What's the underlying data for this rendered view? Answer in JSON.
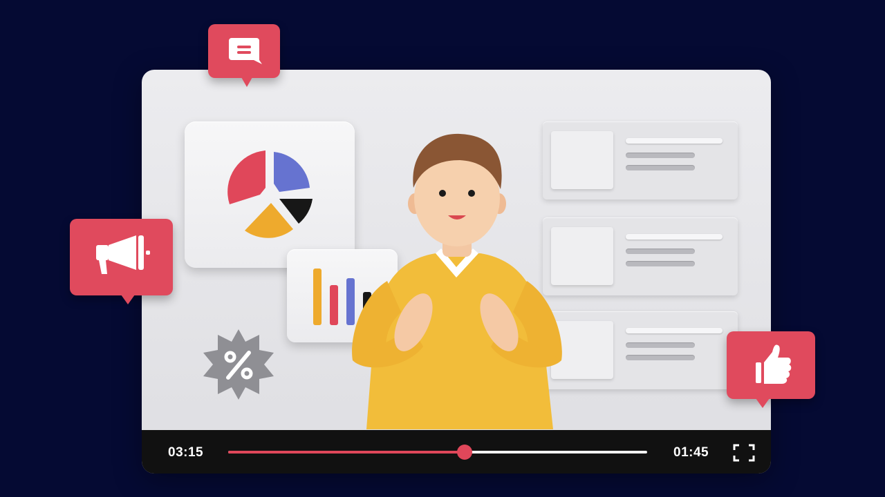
{
  "player": {
    "time_elapsed": "03:15",
    "time_remaining": "01:45",
    "progress_fraction": 0.565,
    "accent_color": "#e0475a",
    "control_bar_color": "#111111",
    "fullscreen_icon": "fullscreen-icon"
  },
  "floating_icons": {
    "chat": "chat-bubble-icon",
    "megaphone": "megaphone-icon",
    "like": "thumbs-up-icon",
    "discount": "percent-badge-icon",
    "bubble_color": "#e04a5d"
  },
  "illustration": {
    "pie_chart_colors": [
      "#e0475a",
      "#6673d0",
      "#171717",
      "#eeaa2d"
    ],
    "bar_chart_colors": [
      "#eeaa2d",
      "#e0475a",
      "#6673d0",
      "#171717"
    ],
    "list_items_count": 3,
    "presenter_sweater_color": "#f2bd3a"
  }
}
